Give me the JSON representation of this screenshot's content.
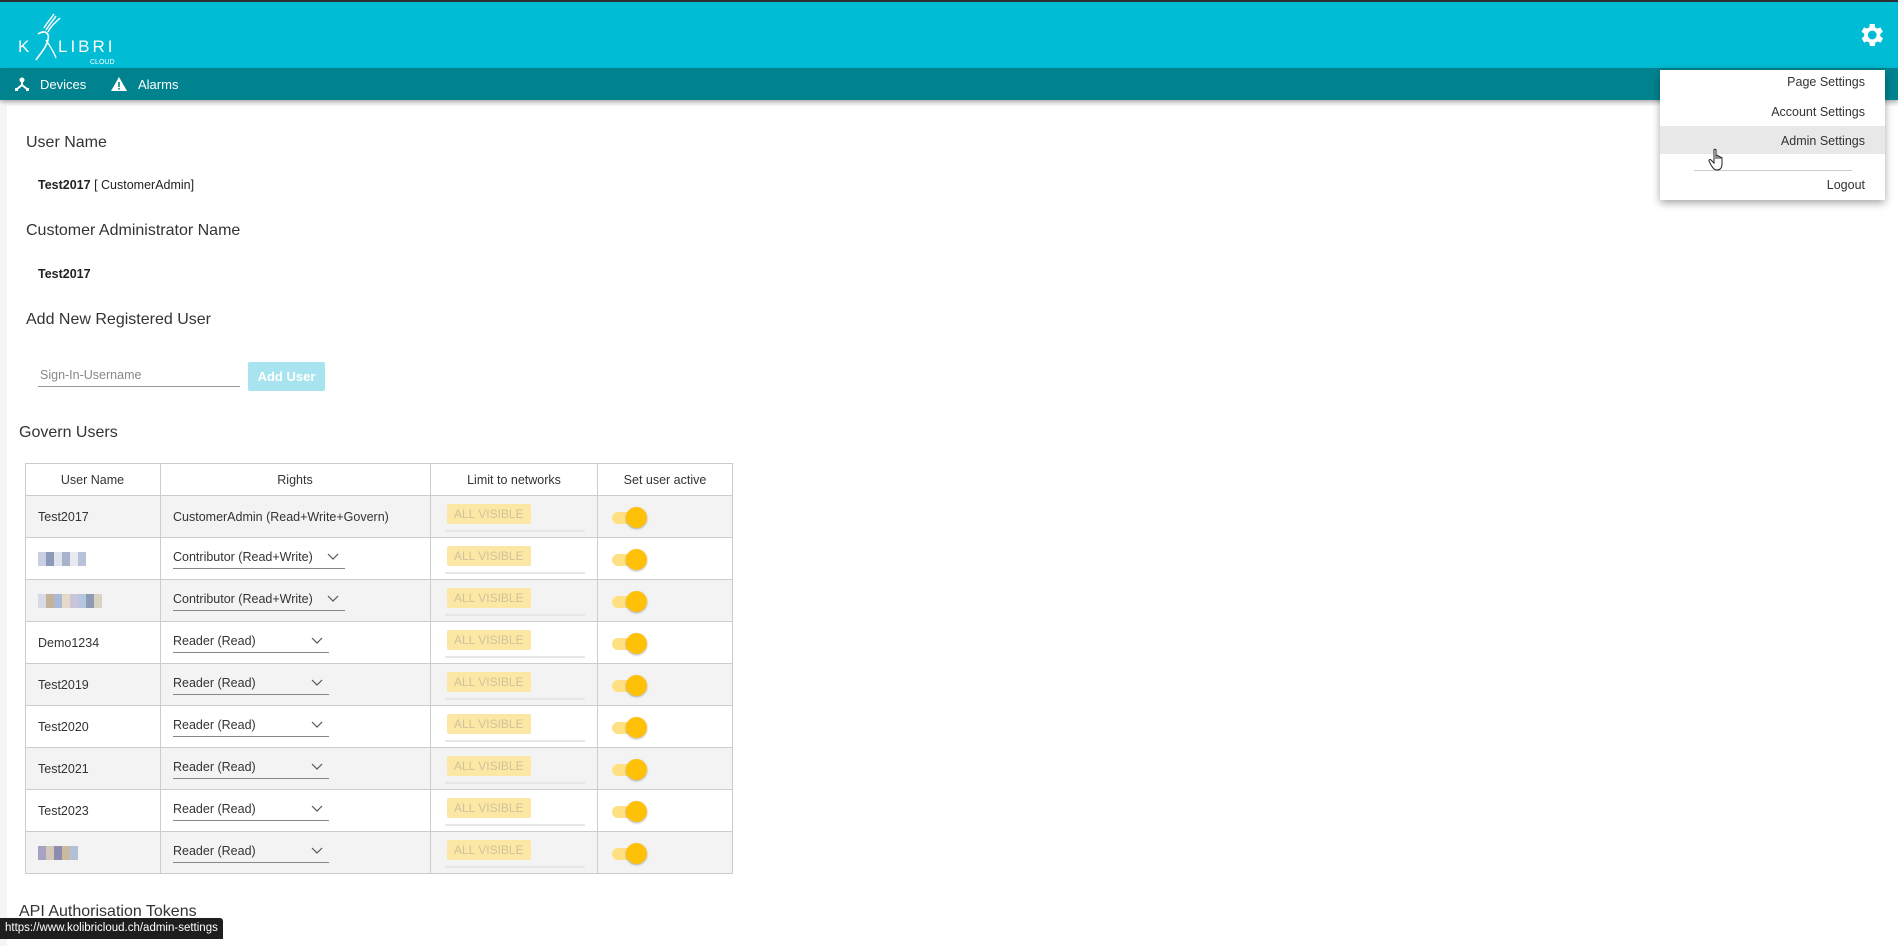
{
  "header": {
    "logo_text": "KOLIBRI",
    "logo_subtext": "CLOUD",
    "settings_icon": "gear-icon"
  },
  "nav": {
    "items": [
      {
        "label": "Devices",
        "icon": "network-icon"
      },
      {
        "label": "Alarms",
        "icon": "warning-icon"
      }
    ]
  },
  "settings_menu": {
    "items": [
      {
        "label": "Page Settings"
      },
      {
        "label": "Account Settings"
      },
      {
        "label": "Admin Settings",
        "highlighted": true
      },
      {
        "label": "Logout"
      }
    ]
  },
  "user_section": {
    "heading": "User Name",
    "name": "Test2017",
    "role": "[ CustomerAdmin]"
  },
  "admin_section": {
    "heading": "Customer Administrator Name",
    "name": "Test2017"
  },
  "add_user": {
    "heading": "Add New Registered User",
    "placeholder": "Sign-In-Username",
    "value": "",
    "button_label": "Add User"
  },
  "govern": {
    "heading": "Govern Users",
    "columns": [
      "User Name",
      "Rights",
      "Limit to networks",
      "Set user active"
    ],
    "rows": [
      {
        "user": "Test2017",
        "rights": "CustomerAdmin (Read+Write+Govern)",
        "editable": false,
        "networks": "ALL VISIBLE",
        "active": true
      },
      {
        "user": "",
        "blurred": true,
        "rights": "Contributor (Read+Write)",
        "editable": true,
        "networks": "ALL VISIBLE",
        "active": true
      },
      {
        "user": "",
        "blurred": true,
        "rights": "Contributor (Read+Write)",
        "editable": true,
        "networks": "ALL VISIBLE",
        "active": true
      },
      {
        "user": "Demo1234",
        "rights": "Reader (Read)",
        "editable": true,
        "networks": "ALL VISIBLE",
        "active": true
      },
      {
        "user": "Test2019",
        "rights": "Reader (Read)",
        "editable": true,
        "networks": "ALL VISIBLE",
        "active": true
      },
      {
        "user": "Test2020",
        "rights": "Reader (Read)",
        "editable": true,
        "networks": "ALL VISIBLE",
        "active": true
      },
      {
        "user": "Test2021",
        "rights": "Reader (Read)",
        "editable": true,
        "networks": "ALL VISIBLE",
        "active": true
      },
      {
        "user": "Test2023",
        "rights": "Reader (Read)",
        "editable": true,
        "networks": "ALL VISIBLE",
        "active": true
      },
      {
        "user": "",
        "blurred": true,
        "rights": "Reader (Read)",
        "editable": true,
        "networks": "ALL VISIBLE",
        "active": true
      }
    ]
  },
  "api_section": {
    "heading": "API Authorisation Tokens"
  },
  "status_bar": {
    "url": "https://www.kolibricloud.ch/admin-settings"
  },
  "colors": {
    "header": "#00bcd4",
    "nav": "#00838f",
    "toggle_on": "#ffc107",
    "chip_bg": "#fde7a5",
    "button_disabled": "#a8e4ef"
  }
}
